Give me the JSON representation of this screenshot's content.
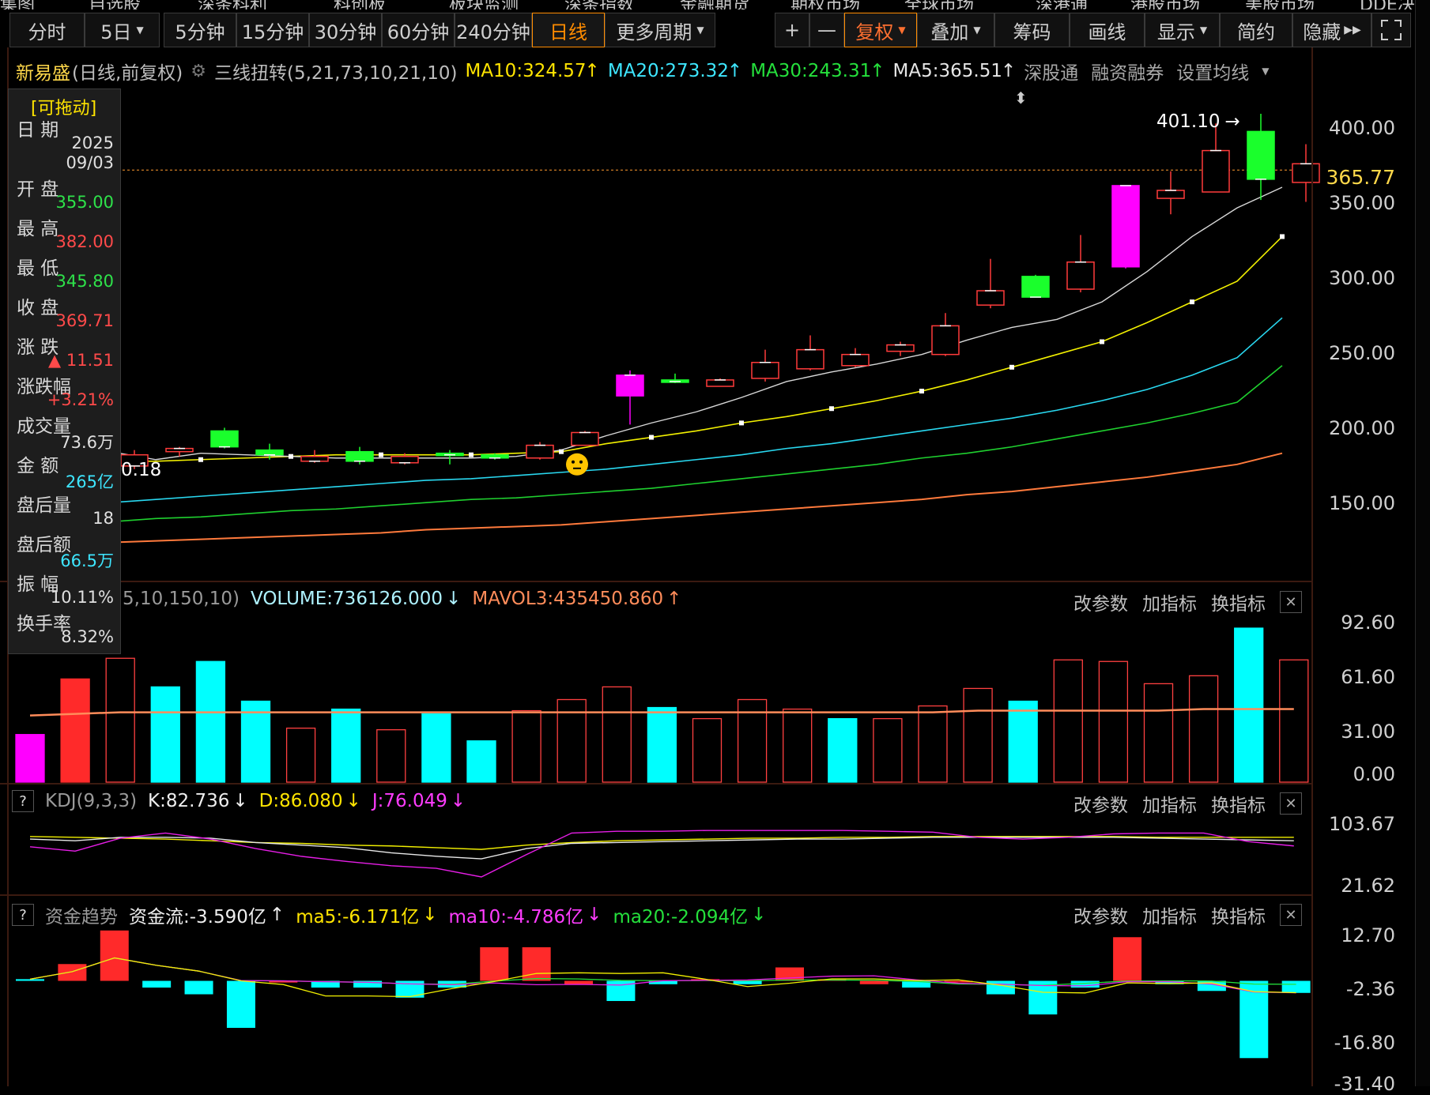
{
  "top_strip": [
    "集图",
    "自选股",
    "深条科利",
    "科创板",
    "板块监测",
    "深条指数",
    "金融期货",
    "期权市场",
    "全球市场",
    "深港通",
    "港股市场",
    "美股市场",
    "DDE决策"
  ],
  "toolbar": {
    "periods": [
      "分时",
      "5日",
      "5分钟",
      "15分钟",
      "30分钟",
      "60分钟",
      "240分钟",
      "日线",
      "更多周期"
    ],
    "active_period": "日线",
    "tools": [
      "+",
      "—",
      "复权",
      "叠加",
      "筹码",
      "画线",
      "显示",
      "简约",
      "隐藏"
    ],
    "expand_icon": "expand-icon"
  },
  "main_header": {
    "stock_name": "新易盛",
    "mode": "(日线,前复权)",
    "indicator": "三线扭转(5,21,73,10,21,10)",
    "ma10": "MA10:324.57",
    "ma20": "MA20:273.32",
    "ma30": "MA30:243.31",
    "ma5": "MA5:365.51",
    "link1": "深股通",
    "link2": "融资融券",
    "link3": "设置均线"
  },
  "info_panel": {
    "title": "[可拖动]",
    "date_label": "日 期",
    "date_year": "2025",
    "date_md": "09/03",
    "open_label": "开 盘",
    "open": "355.00",
    "high_label": "最 高",
    "high": "382.00",
    "low_label": "最 低",
    "low": "345.80",
    "close_label": "收 盘",
    "close": "369.71",
    "change_label": "涨 跌",
    "change": "▲ 11.51",
    "pct_label": "涨跌幅",
    "pct": "+3.21%",
    "vol_label": "成交量",
    "vol": "73.6万",
    "amount_label": "金 额",
    "amount": "265亿",
    "after_vol_label": "盘后量",
    "after_vol": "18",
    "after_amt_label": "盘后额",
    "after_amt": "66.5万",
    "amp_label": "振 幅",
    "amp": "10.11%",
    "turnover_label": "换手率",
    "turnover": "8.32%"
  },
  "price_axis": [
    "400.00",
    "350.00",
    "300.00",
    "250.00",
    "200.00",
    "150.00"
  ],
  "current_price": "365.77",
  "high_marker": "401.10",
  "low_marker": "0.18",
  "volume_panel": {
    "title_prefix": "5,10,150,10)",
    "volume": "VOLUME:736126.000",
    "mavol": "MAVOL3:435450.860",
    "axis": [
      "92.60",
      "61.60",
      "31.00",
      "0.00"
    ],
    "buttons": [
      "改参数",
      "加指标",
      "换指标"
    ]
  },
  "kdj_panel": {
    "name": "KDJ(9,3,3)",
    "k": "K:82.736",
    "d": "D:86.080",
    "j": "J:76.049",
    "axis": [
      "103.67",
      "21.62"
    ],
    "buttons": [
      "改参数",
      "加指标",
      "换指标"
    ]
  },
  "fund_panel": {
    "name": "资金趋势",
    "flow": "资金流:-3.590亿",
    "ma5": "ma5:-6.171亿",
    "ma10": "ma10:-4.786亿",
    "ma20": "ma20:-2.094亿",
    "axis": [
      "12.70",
      "-2.36",
      "-16.80",
      "-31.40"
    ],
    "buttons": [
      "改参数",
      "加指标",
      "换指标"
    ]
  },
  "chart_data": {
    "type": "candlestick",
    "candles": [
      {
        "o": 187,
        "h": 190,
        "l": 178,
        "c": 180
      },
      {
        "o": 189,
        "h": 192,
        "l": 186,
        "c": 191
      },
      {
        "o": 202,
        "h": 204,
        "l": 191,
        "c": 192
      },
      {
        "o": 190,
        "h": 194,
        "l": 184,
        "c": 187
      },
      {
        "o": 186,
        "h": 190,
        "l": 182,
        "c": 183
      },
      {
        "o": 189,
        "h": 192,
        "l": 181,
        "c": 183
      },
      {
        "o": 186,
        "h": 188,
        "l": 181,
        "c": 182
      },
      {
        "o": 188,
        "h": 190,
        "l": 181,
        "c": 187
      },
      {
        "o": 187,
        "h": 188,
        "l": 184,
        "c": 185
      },
      {
        "o": 185,
        "h": 195,
        "l": 184,
        "c": 193
      },
      {
        "o": 193,
        "h": 202,
        "l": 193,
        "c": 201
      },
      {
        "o": 224,
        "h": 240,
        "l": 206,
        "c": 237
      },
      {
        "o": 234,
        "h": 238,
        "l": 232,
        "c": 233
      },
      {
        "o": 230,
        "h": 235,
        "l": 230,
        "c": 234
      },
      {
        "o": 235,
        "h": 253,
        "l": 233,
        "c": 245
      },
      {
        "o": 241,
        "h": 262,
        "l": 240,
        "c": 253
      },
      {
        "o": 243,
        "h": 254,
        "l": 242,
        "c": 250
      },
      {
        "o": 252,
        "h": 258,
        "l": 249,
        "c": 256
      },
      {
        "o": 250,
        "h": 276,
        "l": 249,
        "c": 268
      },
      {
        "o": 281,
        "h": 310,
        "l": 279,
        "c": 290
      },
      {
        "o": 299,
        "h": 300,
        "l": 286,
        "c": 286
      },
      {
        "o": 291,
        "h": 325,
        "l": 289,
        "c": 308
      },
      {
        "o": 305,
        "h": 356,
        "l": 304,
        "c": 356
      },
      {
        "o": 348,
        "h": 365,
        "l": 338,
        "c": 353
      },
      {
        "o": 352,
        "h": 395,
        "l": 353,
        "c": 378
      },
      {
        "o": 390,
        "h": 401.1,
        "l": 347,
        "c": 360
      },
      {
        "o": 358,
        "h": 382,
        "l": 345.8,
        "c": 369.71
      }
    ],
    "candle_colors": [
      "up",
      "up",
      "down",
      "down",
      "up",
      "down",
      "up",
      "down",
      "down",
      "up",
      "up",
      "magenta",
      "down",
      "up",
      "up",
      "up",
      "up",
      "up",
      "up",
      "up",
      "down",
      "up",
      "magenta",
      "up",
      "up",
      "down",
      "up"
    ],
    "ma5": [
      189,
      184,
      188,
      187,
      186,
      185,
      185,
      185,
      185,
      186,
      190,
      199,
      207,
      214,
      223,
      233,
      239,
      244,
      250,
      259,
      267,
      272,
      283,
      302,
      324,
      342,
      355
    ],
    "ma10": [
      183,
      183,
      184,
      185,
      186,
      187,
      187,
      187,
      187,
      188,
      189,
      194,
      198,
      202,
      207,
      211,
      216,
      221,
      227,
      234,
      242,
      250,
      258,
      270,
      283,
      296,
      324
    ],
    "ma20": [
      157,
      159,
      161,
      163,
      165,
      167,
      169,
      171,
      172,
      174,
      176,
      178,
      181,
      184,
      187,
      191,
      194,
      198,
      202,
      206,
      210,
      215,
      221,
      228,
      237,
      248,
      273
    ],
    "ma30": [
      145,
      147,
      148,
      150,
      152,
      153,
      155,
      157,
      159,
      160,
      162,
      164,
      166,
      169,
      172,
      175,
      178,
      181,
      185,
      188,
      192,
      197,
      202,
      207,
      213,
      220,
      243
    ],
    "ma_long": [
      132,
      133,
      134,
      135,
      136,
      137,
      138,
      140,
      141,
      142,
      143,
      145,
      147,
      149,
      151,
      153,
      155,
      157,
      159,
      162,
      164,
      167,
      170,
      173,
      177,
      181,
      188
    ],
    "price_range": [
      108,
      413
    ],
    "volumes": [
      30,
      65,
      78,
      60,
      76,
      51,
      34,
      46,
      33,
      43,
      26,
      45,
      52,
      60,
      47,
      40,
      52,
      46,
      40,
      40,
      48,
      59,
      51,
      77,
      76,
      62,
      67,
      97,
      77
    ],
    "volume_colors": [
      "magenta",
      "red",
      "hollow",
      "cyan",
      "cyan",
      "cyan",
      "hollow",
      "cyan",
      "hollow",
      "cyan",
      "cyan",
      "hollow",
      "hollow",
      "hollow",
      "cyan",
      "hollow",
      "hollow",
      "hollow",
      "cyan",
      "hollow",
      "hollow",
      "hollow",
      "cyan",
      "hollow",
      "hollow",
      "hollow",
      "hollow",
      "cyan",
      "hollow"
    ],
    "mavol3": [
      42,
      43,
      44,
      44,
      44,
      44,
      44,
      44,
      44,
      44,
      44,
      44,
      44,
      44,
      44,
      44,
      44,
      44,
      44,
      44,
      44,
      45,
      45,
      45,
      45,
      45,
      46,
      46,
      46
    ],
    "volume_range": [
      0,
      102
    ],
    "kdj_k": [
      84,
      82,
      86,
      86,
      85,
      80,
      77,
      74,
      68,
      64,
      61,
      73,
      79,
      80,
      81,
      82,
      83,
      84,
      84,
      85,
      86,
      86,
      86,
      86,
      86,
      85,
      84,
      83,
      82
    ],
    "kdj_d": [
      87,
      86,
      85,
      84,
      82,
      80,
      79,
      77,
      76,
      74,
      72,
      77,
      80,
      82,
      83,
      84,
      85,
      85,
      86,
      86,
      87,
      87,
      87,
      87,
      87,
      86,
      86,
      86,
      86
    ],
    "kdj_j": [
      75,
      70,
      85,
      91,
      84,
      73,
      64,
      58,
      53,
      50,
      40,
      66,
      91,
      93,
      93,
      94,
      94,
      94,
      94,
      93,
      92,
      86,
      84,
      86,
      90,
      91,
      91,
      81,
      76
    ],
    "kdj_range": [
      21.62,
      118
    ],
    "fund_flow": [
      0.5,
      5,
      15,
      -2,
      -4,
      -14,
      -0.5,
      -2,
      -2,
      -5,
      -2,
      10,
      10,
      -1,
      -6,
      -1,
      0.5,
      -1,
      4,
      0.5,
      -1,
      -2,
      0,
      -4,
      -10,
      -2,
      13,
      -1,
      -3,
      -23,
      -3.59
    ],
    "fund_colors": [
      "cyan",
      "red",
      "red",
      "cyan",
      "cyan",
      "cyan",
      "red",
      "cyan",
      "cyan",
      "cyan",
      "cyan",
      "red",
      "red",
      "red",
      "cyan",
      "cyan",
      "red",
      "cyan",
      "red",
      "red",
      "red",
      "cyan",
      "red",
      "cyan",
      "cyan",
      "cyan",
      "red",
      "cyan",
      "cyan",
      "cyan",
      "cyan"
    ],
    "fund_range": [
      -31.4,
      18
    ]
  }
}
